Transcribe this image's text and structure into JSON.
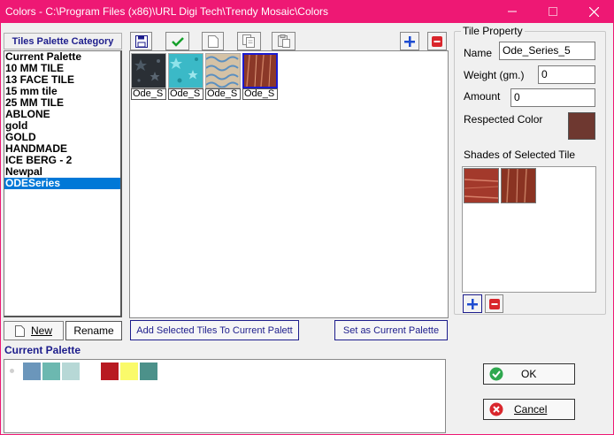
{
  "window": {
    "title": "Colors - C:\\Program Files (x86)\\URL Digi Tech\\Trendy Mosaic\\Colors"
  },
  "categories": {
    "header": "Tiles Palette Category",
    "items": [
      "Current Palette",
      "10 MM TILE",
      "13 FACE TILE",
      "15 mm tile",
      "25 MM TILE",
      "ABLONE",
      "gold",
      "GOLD",
      "HANDMADE",
      "ICE BERG - 2",
      "Newpal",
      "ODESeries"
    ],
    "selected": "ODESeries",
    "new_label": "New",
    "rename_label": "Rename"
  },
  "toolbar": {
    "icons": [
      "save-icon",
      "check-icon",
      "new-page-icon",
      "copy-icon",
      "paste-icon",
      "plus-icon",
      "minus-icon"
    ]
  },
  "tiles": [
    {
      "label": "Ode_S",
      "color": "#2a2f35",
      "pattern": "dark-stars"
    },
    {
      "label": "Ode_S",
      "color": "#3bb9c7",
      "pattern": "teal-stars"
    },
    {
      "label": "Ode_S",
      "color": "#d4c2a6",
      "pattern": "waves"
    },
    {
      "label": "Ode_S",
      "color": "#8b3828",
      "pattern": "streaks",
      "selected": true
    }
  ],
  "actions": {
    "add_selected": "Add Selected Tiles To Current Palett",
    "set_current": "Set as Current Palette"
  },
  "current_palette": {
    "title": "Current Palette",
    "colors": [
      "#6b96bb",
      "#6cb8b0",
      "#b7d8d6",
      "#b81a22",
      "#fafa6a",
      "#4c918a"
    ]
  },
  "tile_property": {
    "legend": "Tile Property",
    "name_label": "Name",
    "name_value": "Ode_Series_5",
    "weight_label": "Weight (gm.)",
    "weight_value": "0",
    "amount_label": "Amount",
    "amount_value": "0",
    "respected_label": "Respected Color",
    "respected_color": "#6e3830",
    "shades_label": "Shades of Selected Tile",
    "shades": [
      "#a3392b",
      "#8a3322"
    ]
  },
  "dialog": {
    "ok_label": "OK",
    "cancel_label": "Cancel"
  },
  "colors": {
    "titlebar": "#ee1874",
    "selection": "#0078d7",
    "accent_text": "#1d1d8c"
  }
}
